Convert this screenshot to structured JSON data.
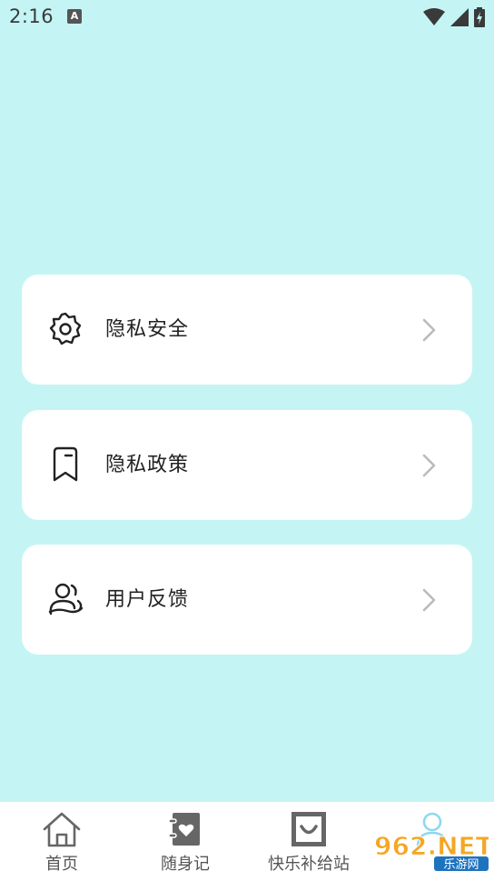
{
  "status": {
    "time": "2:16",
    "badge": "A"
  },
  "menu": [
    {
      "label": "隐私安全",
      "icon": "gear-icon"
    },
    {
      "label": "隐私政策",
      "icon": "bookmark-icon"
    },
    {
      "label": "用户反馈",
      "icon": "users-icon"
    }
  ],
  "tabs": [
    {
      "label": "首页",
      "icon": "home-icon"
    },
    {
      "label": "随身记",
      "icon": "notebook-heart-icon"
    },
    {
      "label": "快乐补给站",
      "icon": "smile-box-icon"
    },
    {
      "label": "",
      "icon": "profile-icon"
    }
  ],
  "watermark": {
    "brand": "962.NET",
    "subtitle": "乐游网"
  },
  "colors": {
    "background": "#c4f5f4",
    "card": "#ffffff"
  }
}
